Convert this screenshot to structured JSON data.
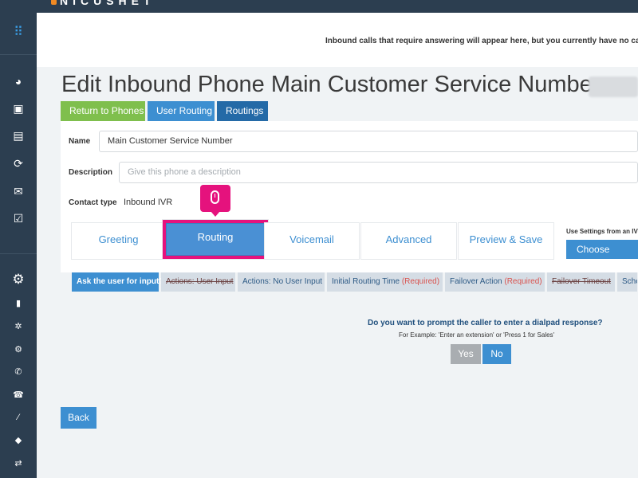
{
  "header": {
    "logo_text": "NICUSHET"
  },
  "sidebar": {
    "items": [
      {
        "name": "dialpad-icon",
        "glyph": "⠿"
      },
      {
        "name": "pie-chart-icon",
        "glyph": "◕"
      },
      {
        "name": "contacts-icon",
        "glyph": "▣"
      },
      {
        "name": "chat-icon",
        "glyph": "▤"
      },
      {
        "name": "network-icon",
        "glyph": "⟳"
      },
      {
        "name": "mail-icon",
        "glyph": "✉"
      },
      {
        "name": "task-icon",
        "glyph": "☑"
      },
      {
        "name": "settings-gear-icon",
        "glyph": "⚙"
      },
      {
        "name": "building-icon",
        "glyph": "▮"
      },
      {
        "name": "cog-icon",
        "glyph": "✲"
      },
      {
        "name": "cogs-icon",
        "glyph": "⚙"
      },
      {
        "name": "phone-icon",
        "glyph": "✆"
      },
      {
        "name": "phone-book-icon",
        "glyph": "☎"
      },
      {
        "name": "magic-wand-icon",
        "glyph": "⁄"
      },
      {
        "name": "tag-icon",
        "glyph": "◆"
      },
      {
        "name": "transfer-icon",
        "glyph": "⇄"
      }
    ]
  },
  "notice": {
    "text": "Inbound calls that require answering will appear here, but you currently have no calls"
  },
  "page": {
    "title": "Edit Inbound Phone Main Customer Service Number"
  },
  "top_tabs": {
    "return": "Return to Phones",
    "user_routing": "User Routing",
    "routings": "Routings"
  },
  "form": {
    "name_label": "Name",
    "name_value": "Main Customer Service Number",
    "description_label": "Description",
    "description_placeholder": "Give this phone a description",
    "contact_type_label": "Contact type",
    "contact_type_value": "Inbound IVR"
  },
  "wizard": {
    "tabs": [
      "Greeting",
      "Routing",
      "Voicemail",
      "Advanced",
      "Preview & Save"
    ],
    "ivr_label": "Use Settings from an IVR T",
    "choose_label": "Choose"
  },
  "substeps": {
    "ask": "Ask the user for input?",
    "actions_user_input": "Actions: User Input",
    "actions_no_user_input": "Actions: No User Input",
    "initial_routing_time": "Initial Routing Time",
    "failover_action": "Failover Action",
    "required": "(Required)",
    "failover_timeout": "Failover Timeout",
    "sched": "Sche"
  },
  "question": {
    "main": "Do you want to prompt the caller to enter a dialpad response?",
    "example": "For Example: 'Enter an extension' or 'Press 1 for Sales'",
    "yes": "Yes",
    "no": "No"
  },
  "back_label": "Back",
  "colors": {
    "sidebar_bg": "#2c3e50",
    "accent_blue": "#3d8fd1",
    "return_green": "#7fbf4d",
    "highlight_pink": "#e5127d",
    "dark_blue": "#246aa7"
  }
}
